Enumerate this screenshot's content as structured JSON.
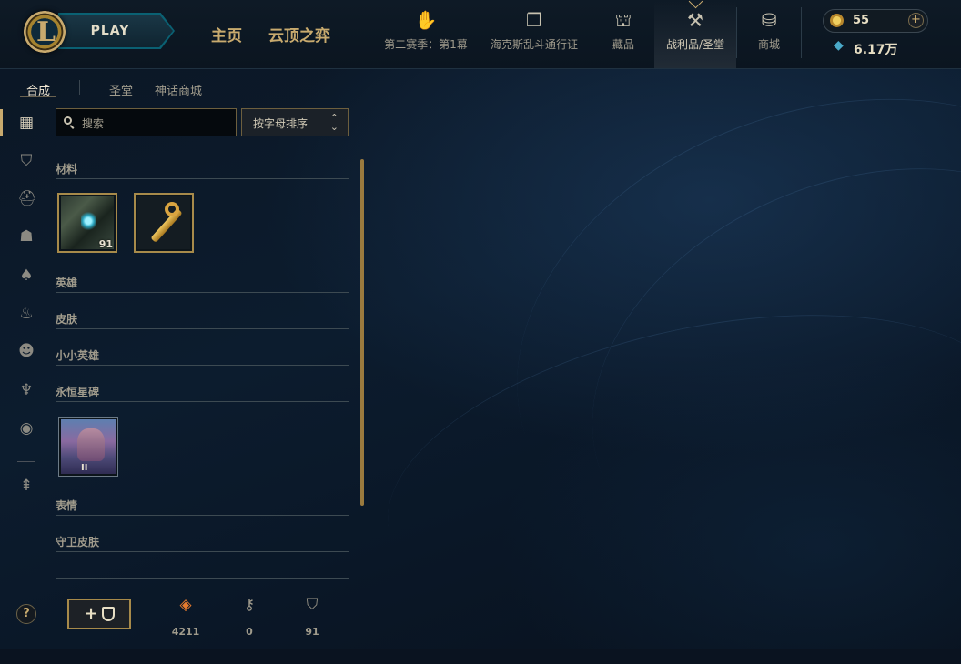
{
  "topbar": {
    "play_label": "PLAY",
    "main_nav": [
      "主页",
      "云顶之弈"
    ],
    "nav_items": [
      {
        "label": "第二赛季：第1幕",
        "icon": "season-icon"
      },
      {
        "label": "海克斯乱斗通行证",
        "icon": "pass-icon"
      },
      {
        "label": "藏品",
        "icon": "collection-icon"
      },
      {
        "label": "战利品/圣堂",
        "icon": "loot-icon",
        "active": true
      },
      {
        "label": "商城",
        "icon": "store-icon"
      }
    ],
    "rp_value": "55",
    "be_value": "6.17万",
    "rp_plus": "+"
  },
  "subtabs": {
    "craft": "合成",
    "sanctum": "圣堂",
    "mythic_shop": "神话商城"
  },
  "filters": {
    "search_placeholder": "搜索",
    "sort_label": "按字母排序",
    "sort_arrow": "⌃⌄"
  },
  "sections": {
    "materials": "材料",
    "champions": "英雄",
    "skins": "皮肤",
    "tacticians": "小小英雄",
    "eternals": "永恒星碑",
    "emotes": "表情",
    "ward_skins": "守卫皮肤"
  },
  "loot": {
    "chest_count": "91",
    "emote_tier": "II"
  },
  "bottom": {
    "craft_plus": "+",
    "orange_essence": "4211",
    "keys": "0",
    "chests": "91"
  },
  "help_label": "?",
  "colors": {
    "gold": "#c8aa6e",
    "text_muted": "#a09b8c",
    "accent_blue": "#0a9cb4",
    "orange_essence": "#e77b2e"
  }
}
